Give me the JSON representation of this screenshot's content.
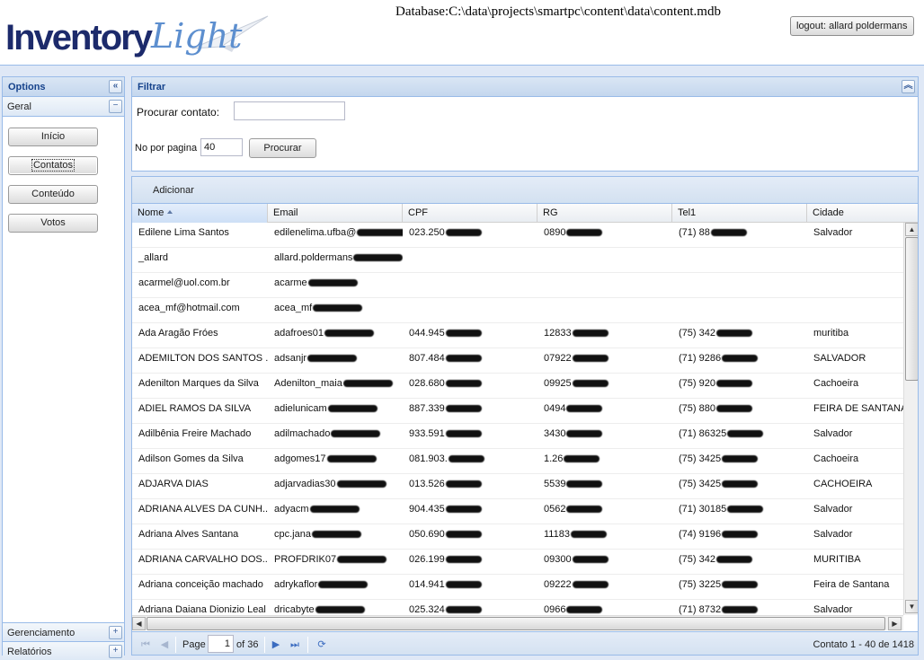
{
  "header": {
    "logo_inventory": "Inventory",
    "logo_light": "Light",
    "db_path": "Database:C:\\data\\projects\\smartpc\\content\\data\\content.mdb",
    "logout_label": "logout: allard poldermans"
  },
  "sidebar": {
    "title": "Options",
    "sections": [
      {
        "label": "Geral",
        "toggle": "−"
      },
      {
        "label": "Gerenciamento",
        "toggle": "+"
      },
      {
        "label": "Relatórios",
        "toggle": "+"
      }
    ],
    "buttons": [
      {
        "label": "Início"
      },
      {
        "label": "Contatos"
      },
      {
        "label": "Conteúdo"
      },
      {
        "label": "Votos"
      }
    ]
  },
  "filter": {
    "title": "Filtrar",
    "search_label": "Procurar contato:",
    "search_value": "",
    "per_page_label": "No por pagina",
    "per_page_value": "40",
    "submit_label": "Procurar"
  },
  "grid": {
    "toolbar_add": "Adicionar",
    "columns": [
      "Nome",
      "Email",
      "CPF",
      "RG",
      "Tel1",
      "Cidade"
    ],
    "rows": [
      {
        "nome": "Edilene Lima Santos",
        "email": "edilenelima.ufba@",
        "cpf": "023.250",
        "rg": "0890",
        "tel": "(71) 88",
        "cidade": "Salvador"
      },
      {
        "nome": "_allard",
        "email": "allard.poldermans",
        "cpf": "",
        "rg": "",
        "tel": "",
        "cidade": ""
      },
      {
        "nome": "acarmel@uol.com.br",
        "email": "acarme",
        "cpf": "",
        "rg": "",
        "tel": "",
        "cidade": ""
      },
      {
        "nome": "acea_mf@hotmail.com",
        "email": "acea_mf",
        "cpf": "",
        "rg": "",
        "tel": "",
        "cidade": ""
      },
      {
        "nome": "Ada Aragão Fróes",
        "email": "adafroes01",
        "cpf": "044.945",
        "rg": "12833",
        "tel": "(75) 342",
        "cidade": "muritiba"
      },
      {
        "nome": "ADEMILTON DOS SANTOS ...",
        "email": "adsanjr",
        "cpf": "807.484",
        "rg": "07922",
        "tel": "(71) 9286",
        "cidade": "SALVADOR"
      },
      {
        "nome": "Adenilton Marques da Silva",
        "email": "Adenilton_maia",
        "cpf": "028.680",
        "rg": "09925",
        "tel": "(75) 920",
        "cidade": "Cachoeira"
      },
      {
        "nome": "ADIEL RAMOS DA SILVA",
        "email": "adielunicam",
        "cpf": "887.339",
        "rg": "0494",
        "tel": "(75) 880",
        "cidade": "FEIRA DE SANTANA"
      },
      {
        "nome": "Adilbênia Freire Machado",
        "email": "adilmachado",
        "cpf": "933.591",
        "rg": "3430",
        "tel": "(71) 86325",
        "cidade": "Salvador"
      },
      {
        "nome": "Adilson Gomes da Silva",
        "email": "adgomes17",
        "cpf": "081.903.",
        "rg": "1.26",
        "tel": "(75) 3425",
        "cidade": "Cachoeira"
      },
      {
        "nome": "ADJARVA DIAS",
        "email": "adjarvadias30",
        "cpf": "013.526",
        "rg": "5539",
        "tel": "(75) 3425",
        "cidade": "CACHOEIRA"
      },
      {
        "nome": "ADRIANA ALVES DA CUNH...",
        "email": "adyacm",
        "cpf": "904.435",
        "rg": "0562",
        "tel": "(71) 30185",
        "cidade": "Salvador"
      },
      {
        "nome": "Adriana Alves Santana",
        "email": "cpc.jana",
        "cpf": "050.690",
        "rg": "11183",
        "tel": "(74) 9196",
        "cidade": "Salvador"
      },
      {
        "nome": "ADRIANA CARVALHO DOS...",
        "email": "PROFDRIK07",
        "cpf": "026.199",
        "rg": "09300",
        "tel": "(75) 342",
        "cidade": "MURITIBA"
      },
      {
        "nome": "Adriana conceição machado",
        "email": "adrykaflor",
        "cpf": "014.941",
        "rg": "09222",
        "tel": "(75) 3225",
        "cidade": "Feira de Santana"
      },
      {
        "nome": "Adriana Daiana Dionizio Leal",
        "email": "dricabyte",
        "cpf": "025.324",
        "rg": "0966",
        "tel": "(71) 8732",
        "cidade": "Salvador"
      }
    ]
  },
  "paging": {
    "page_label": "Page",
    "page_value": "1",
    "of_label": "of 36",
    "summary": "Contato 1 - 40 de 1418"
  }
}
